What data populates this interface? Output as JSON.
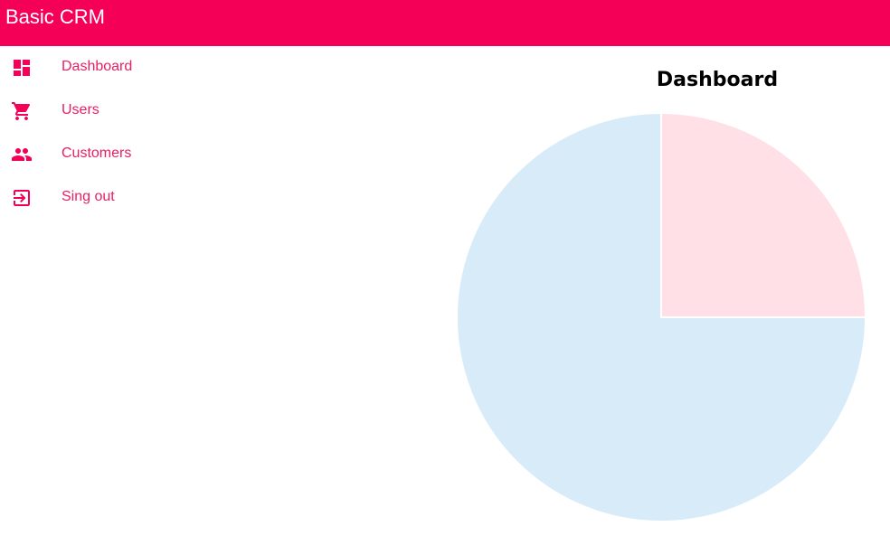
{
  "app": {
    "title": "Basic CRM"
  },
  "theme": {
    "primary": "#f50057",
    "nav_text": "#e91e63"
  },
  "sidebar": {
    "items": [
      {
        "label": "Dashboard",
        "icon": "dashboard-icon"
      },
      {
        "label": "Users",
        "icon": "shopping-cart-icon"
      },
      {
        "label": "Customers",
        "icon": "people-icon"
      },
      {
        "label": "Sing out",
        "icon": "exit-icon"
      }
    ]
  },
  "main": {
    "chart_title": "Dashboard"
  },
  "chart_data": {
    "type": "pie",
    "title": "Dashboard",
    "values": [
      25,
      75
    ],
    "colors": [
      "#ffe0e6",
      "#d7ebf8"
    ],
    "border_color": "#ffffff",
    "legend": "none"
  }
}
